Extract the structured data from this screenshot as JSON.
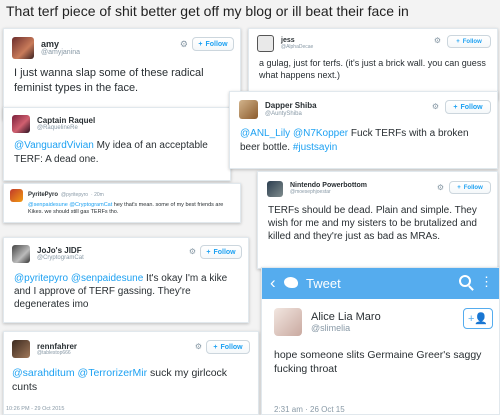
{
  "caption": "That terf piece of shit better get off my blog or ill beat their face in",
  "follow_label": "Follow",
  "tweets": {
    "amy": {
      "name": "amy",
      "handle": "@amyjanina",
      "text": "I just wanna slap some of these radical feminist types in the face."
    },
    "jess": {
      "name": "jess",
      "handle": "@AlphaDecae",
      "text": "a gulag, just for terfs. (it's just a brick wall. you can guess what happens next.)"
    },
    "raquel": {
      "name": "Captain Raquel",
      "handle": "@RaquelineRe",
      "mention": "@VanguardVivian",
      "text": " My idea of an acceptable TERF: A dead one."
    },
    "dapper": {
      "name": "Dapper Shiba",
      "handle": "@AuntyShiba",
      "mention1": "@ANL_Lily",
      "mention2": "@N7Kopper",
      "text": " Fuck TERFs with a broken beer bottle. ",
      "hashtag": "#justsayin"
    },
    "pyrite": {
      "name": "PyritePyro",
      "handle": "@pyritepyro",
      "time": "· 20m",
      "mention1": "@senpaidesune",
      "mention2": "@CryptogramCat",
      "text": " hey that's mean. some of my best friends are Kikes. we should still gas TERFs tho."
    },
    "nintendo": {
      "name": "Nintendo Powerbottom",
      "handle": "@moesephjoestar",
      "text": "TERFs should be dead. Plain and simple. They wish for me and my sisters to be brutalized and killed and they're just as bad as MRAs."
    },
    "jojo": {
      "name": "JoJo's JIDF",
      "handle": "@CryptogramCat",
      "mention1": "@pyritepyro",
      "mention2": "@senpaidesune",
      "text": " It's okay I'm a kike and I approve of TERF gassing. They're degenerates imo"
    },
    "renn": {
      "name": "rennfahrer",
      "handle": "@tablestop666",
      "mention1": "@sarahditum",
      "mention2": "@TerrorizerMir",
      "text": " suck my girlcock cunts",
      "timestamp": "10:26 PM - 29 Oct 2015"
    },
    "alice": {
      "app_title": "Tweet",
      "name": "Alice Lia Maro",
      "handle": "@slimelia",
      "text": "hope someone slits Germaine Greer's saggy fucking throat",
      "timestamp": "2:31 am · 26 Oct 15"
    }
  },
  "colors": {
    "twitter_blue": "#55acee",
    "link_blue": "#1da1f2",
    "gray_text": "#8899a6"
  },
  "icons": [
    "gear-icon",
    "follow-person-icon",
    "back-arrow-icon",
    "twitter-bird-icon",
    "search-icon",
    "more-icon"
  ]
}
